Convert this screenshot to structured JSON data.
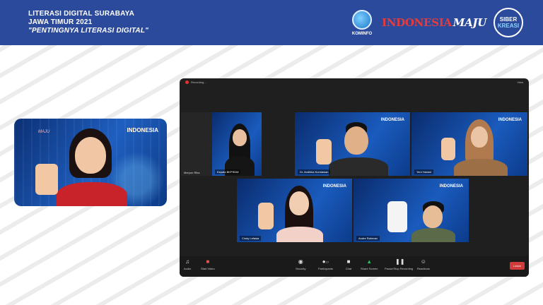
{
  "banner": {
    "line1": "LITERASI DIGITAL SURABAYA",
    "line2": "JAWA TIMUR 2021",
    "line3": "\"PENTINGNYA LITERASI DIGITAL\"",
    "kominfo_label": "KOMINFO",
    "indonesia_text": "INDONESIA",
    "maju_text": "MAJU",
    "siber_top": "SIBER",
    "siber_bottom": "KREASI",
    "colors": {
      "banner": "#2c4a9b",
      "indonesia_red": "#e63b3b"
    }
  },
  "speaker_tile": {
    "brand": "INDONESIA",
    "brand_sub": "",
    "logo_strip": "MAJU"
  },
  "zoom": {
    "top_bar": {
      "recording": "Recording...",
      "view": "View"
    },
    "participants": [
      {
        "name": "Meryon Rika"
      },
      {
        "name": "Kepala BKPSDM"
      },
      {
        "name": "Dr. Andhika Kurniawan"
      },
      {
        "name": "Yeni Harsini"
      },
      {
        "name": "Cindy Lefasia"
      },
      {
        "name": "Andre Rahman"
      }
    ],
    "toolbar": {
      "audio": "Audio",
      "video": "Start Video",
      "security": "Security",
      "participants": "Participants",
      "participants_count": "77",
      "chat": "Chat",
      "share": "Share Screen",
      "record": "Pause/Stop Recording",
      "reactions": "Reactions",
      "leave": "Leave"
    },
    "tile_brand": "INDONESIA"
  }
}
